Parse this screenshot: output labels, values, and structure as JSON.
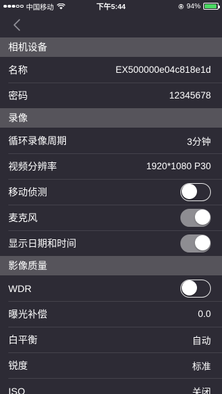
{
  "status_bar": {
    "carrier": "中国移动",
    "time": "下午5:44",
    "battery_text": "94%",
    "battery_level": 0.94,
    "battery_color": "#4cd964"
  },
  "nav": {
    "back_icon": "chevron-left-icon"
  },
  "sections": {
    "camera": {
      "title": "相机设备",
      "name_label": "名称",
      "name_value": "EX500000e04c818e1d",
      "password_label": "密码",
      "password_value": "12345678"
    },
    "recording": {
      "title": "录像",
      "loop_label": "循环录像周期",
      "loop_value": "3分钟",
      "resolution_label": "视频分辨率",
      "resolution_value": "1920*1080 P30",
      "motion_label": "移动侦测",
      "motion_on": false,
      "mic_label": "麦克风",
      "mic_on": true,
      "datetime_label": "显示日期和时间",
      "datetime_on": true
    },
    "image_quality": {
      "title": "影像质量",
      "wdr_label": "WDR",
      "wdr_on": false,
      "exposure_label": "曝光补偿",
      "exposure_value": "0.0",
      "wb_label": "白平衡",
      "wb_value": "自动",
      "sharpness_label": "锐度",
      "sharpness_value": "标准",
      "iso_label": "ISO",
      "iso_value": "关闭"
    }
  },
  "colors": {
    "background": "#2d2b35",
    "section_header": "#56545b",
    "toggle_on": "#8e8d92"
  }
}
